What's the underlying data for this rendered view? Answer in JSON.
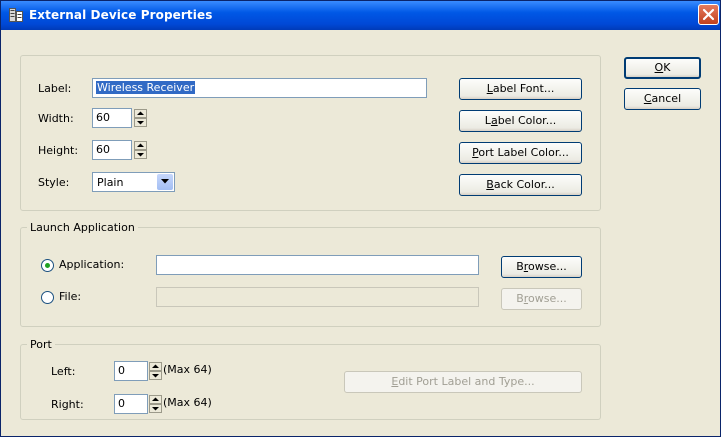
{
  "window": {
    "title": "External Device Properties"
  },
  "icons": {
    "app": "device-properties-icon",
    "close": "close-icon"
  },
  "colors": {
    "titlebar": "#0058e6",
    "face": "#ece9d8",
    "selection": "#316ac5",
    "close": "#c1401d"
  },
  "props": {
    "label_label": "Label:",
    "label_value": "Wireless Receiver",
    "width_label": "Width:",
    "width_value": "60",
    "height_label": "Height:",
    "height_value": "60",
    "style_label": "Style:",
    "style_value": "Plain",
    "label_font_button": {
      "u": "L",
      "rest": "abel Font..."
    },
    "label_color_button": {
      "pre": "L",
      "u": "a",
      "rest": "bel Color..."
    },
    "port_label_color_button": {
      "u": "P",
      "rest": "ort Label Color..."
    },
    "back_color_button": {
      "u": "B",
      "rest": "ack Color..."
    }
  },
  "launch": {
    "title": "Launch Application",
    "application_label": "Application:",
    "application_value": "",
    "file_label": "File:",
    "file_value": "",
    "browse_label": {
      "pre": "B",
      "u": "r",
      "rest": "owse..."
    },
    "browse_file_label": {
      "pre": "B",
      "u": "r",
      "rest": "owse..."
    }
  },
  "port": {
    "title": "Port",
    "left_label": "Left:",
    "left_value": "0",
    "left_max": "(Max 64)",
    "right_label": "Right:",
    "right_value": "0",
    "right_max": "(Max 64)",
    "edit_button": {
      "u": "E",
      "rest": "dit Port Label and Type..."
    }
  },
  "dialog": {
    "ok": {
      "u": "O",
      "rest": "K"
    },
    "cancel": {
      "u": "C",
      "rest": "ancel"
    }
  }
}
